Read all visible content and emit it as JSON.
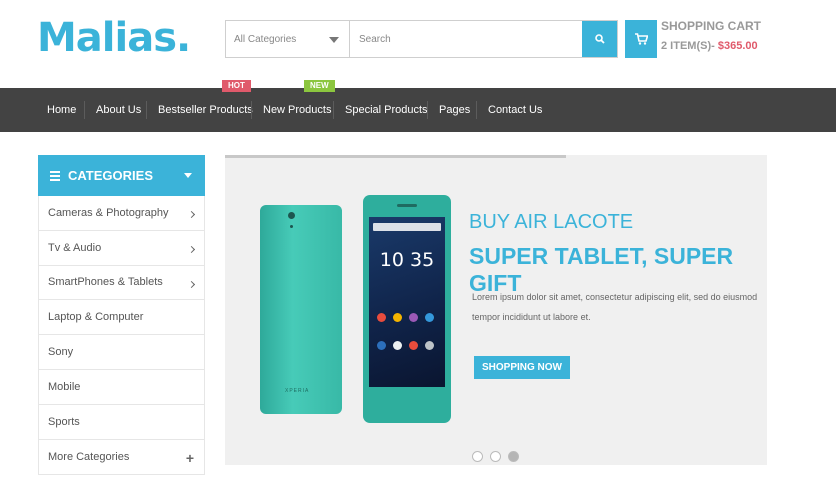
{
  "header": {
    "logo": "Malias.",
    "category_select": "All Categories",
    "search_placeholder": "Search",
    "cart": {
      "title": "SHOPPING CART",
      "count_label": "2 ITEM(S)",
      "separator": "-",
      "total": "$365.00"
    }
  },
  "nav": {
    "items": [
      {
        "label": "Home"
      },
      {
        "label": "About Us"
      },
      {
        "label": "Bestseller Products"
      },
      {
        "label": "New Products"
      },
      {
        "label": "Special Products"
      },
      {
        "label": "Pages"
      },
      {
        "label": "Contact Us"
      }
    ],
    "badges": {
      "hot": "HOT",
      "new": "NEW"
    }
  },
  "sidebar": {
    "title": "CATEGORIES",
    "items": [
      {
        "label": "Cameras & Photography"
      },
      {
        "label": "Tv & Audio"
      },
      {
        "label": "SmartPhones & Tablets"
      },
      {
        "label": "Laptop & Computer"
      },
      {
        "label": "Sony"
      },
      {
        "label": "Mobile"
      },
      {
        "label": "Sports"
      },
      {
        "label": "More Categories"
      }
    ]
  },
  "banner": {
    "title1": "BUY AIR LACOTE",
    "title2": "SUPER TABLET, SUPER GIFT",
    "text_line1": "Lorem ipsum dolor sit amet, consectetur adipiscing elit, sed do eiusmod",
    "text_line2": "tempor incididunt ut labore et.",
    "button": "SHOPPING NOW",
    "phone_time": "10 35",
    "phone_brand": "XPERIA",
    "slide_count": 3,
    "active_slide": 3,
    "slide_progress": 0.63
  },
  "colors": {
    "accent": "#3bb3d9",
    "nav_bg": "#434343",
    "hot": "#e05a6b",
    "new": "#8cc63f",
    "price": "#e05a6b"
  }
}
